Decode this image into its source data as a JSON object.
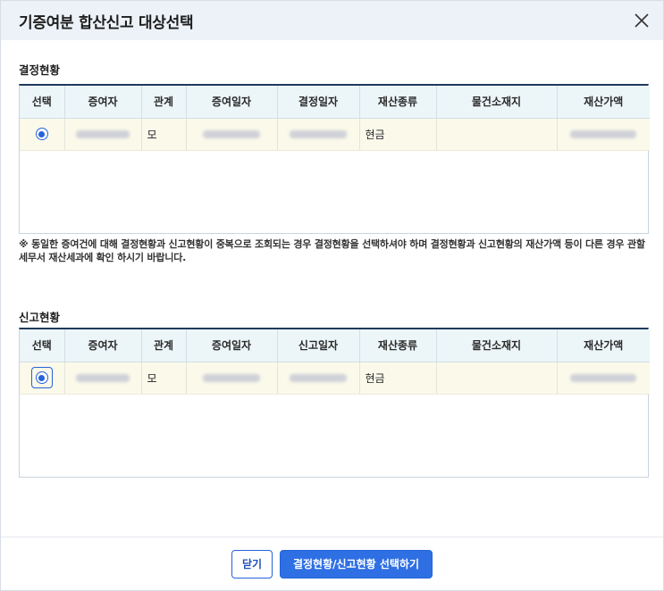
{
  "dialog": {
    "title": "기증여분 합산신고 대상선택",
    "close_icon": "close-icon"
  },
  "decision": {
    "section_title": "결정현황",
    "columns": [
      "선택",
      "증여자",
      "관계",
      "증여일자",
      "결정일자",
      "재산종류",
      "물건소재지",
      "재산가액"
    ],
    "rows": [
      {
        "selected": true,
        "donor": "",
        "relation": "모",
        "gift_date": "",
        "decision_date": "",
        "asset_type": "현금",
        "location": "",
        "asset_value": ""
      }
    ]
  },
  "note": "※ 동일한 증여건에 대해 결정현황과 신고현황이 중복으로 조회되는 경우 결정현황을 선택하셔야 하며 결정현황과 신고현황의 재산가액 등이 다른 경우 관할세무서 재산세과에 확인 하시기 바랍니다.",
  "report": {
    "section_title": "신고현황",
    "columns": [
      "선택",
      "증여자",
      "관계",
      "증여일자",
      "신고일자",
      "재산종류",
      "물건소재지",
      "재산가액"
    ],
    "rows": [
      {
        "selected": true,
        "donor": "",
        "relation": "모",
        "gift_date": "",
        "report_date": "",
        "asset_type": "현금",
        "location": "",
        "asset_value": ""
      }
    ]
  },
  "footer": {
    "close_label": "닫기",
    "select_label": "결정현황/신고현황 선택하기"
  },
  "colors": {
    "accent": "#2563d9",
    "header_bg": "#edf2f8",
    "row_highlight": "#fbf9ea",
    "th_bg": "#ecf5f8"
  }
}
